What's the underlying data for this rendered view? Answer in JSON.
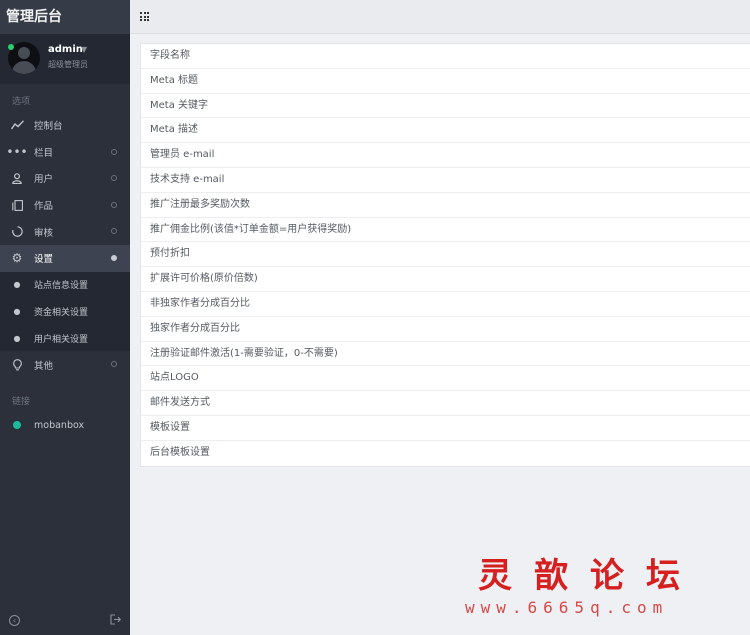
{
  "app": {
    "title": "管理后台"
  },
  "user": {
    "name": "admin",
    "role": "超级管理员"
  },
  "sidebar": {
    "options_label": "选项",
    "menu": [
      {
        "label": "控制台",
        "icon": "chart-line-icon"
      },
      {
        "label": "栏目",
        "icon": "more-dots-icon"
      },
      {
        "label": "用户",
        "icon": "user-icon"
      },
      {
        "label": "作品",
        "icon": "copy-icon"
      },
      {
        "label": "审核",
        "icon": "spinner-icon"
      },
      {
        "label": "设置",
        "icon": "gear-icon",
        "active": true
      },
      {
        "label": "其他",
        "icon": "lightbulb-icon"
      }
    ],
    "submenu": [
      {
        "label": "站点信息设置"
      },
      {
        "label": "资金相关设置"
      },
      {
        "label": "用户相关设置"
      }
    ],
    "links_label": "链接",
    "links": [
      {
        "label": "mobanbox",
        "color": "#1abc9c"
      }
    ]
  },
  "settings": {
    "rows": [
      "字段名称",
      "Meta 标题",
      "Meta 关键字",
      "Meta 描述",
      "管理员 e-mail",
      "技术支持 e-mail",
      "推广注册最多奖励次数",
      "推广佣金比例(该值*订单金额=用户获得奖励)",
      "预付折扣",
      "扩展许可价格(原价倍数)",
      "非独家作者分成百分比",
      "独家作者分成百分比",
      "注册验证邮件激活(1-需要验证，0-不需要)",
      "站点LOGO",
      "邮件发送方式",
      "模板设置",
      "后台模板设置"
    ]
  },
  "watermark": {
    "title": "灵歆论坛",
    "url": "www.6665q.com"
  },
  "colors": {
    "sidebar_bg": "#2b303b",
    "accent_green": "#2ecc71",
    "watermark_red": "#d62020"
  }
}
